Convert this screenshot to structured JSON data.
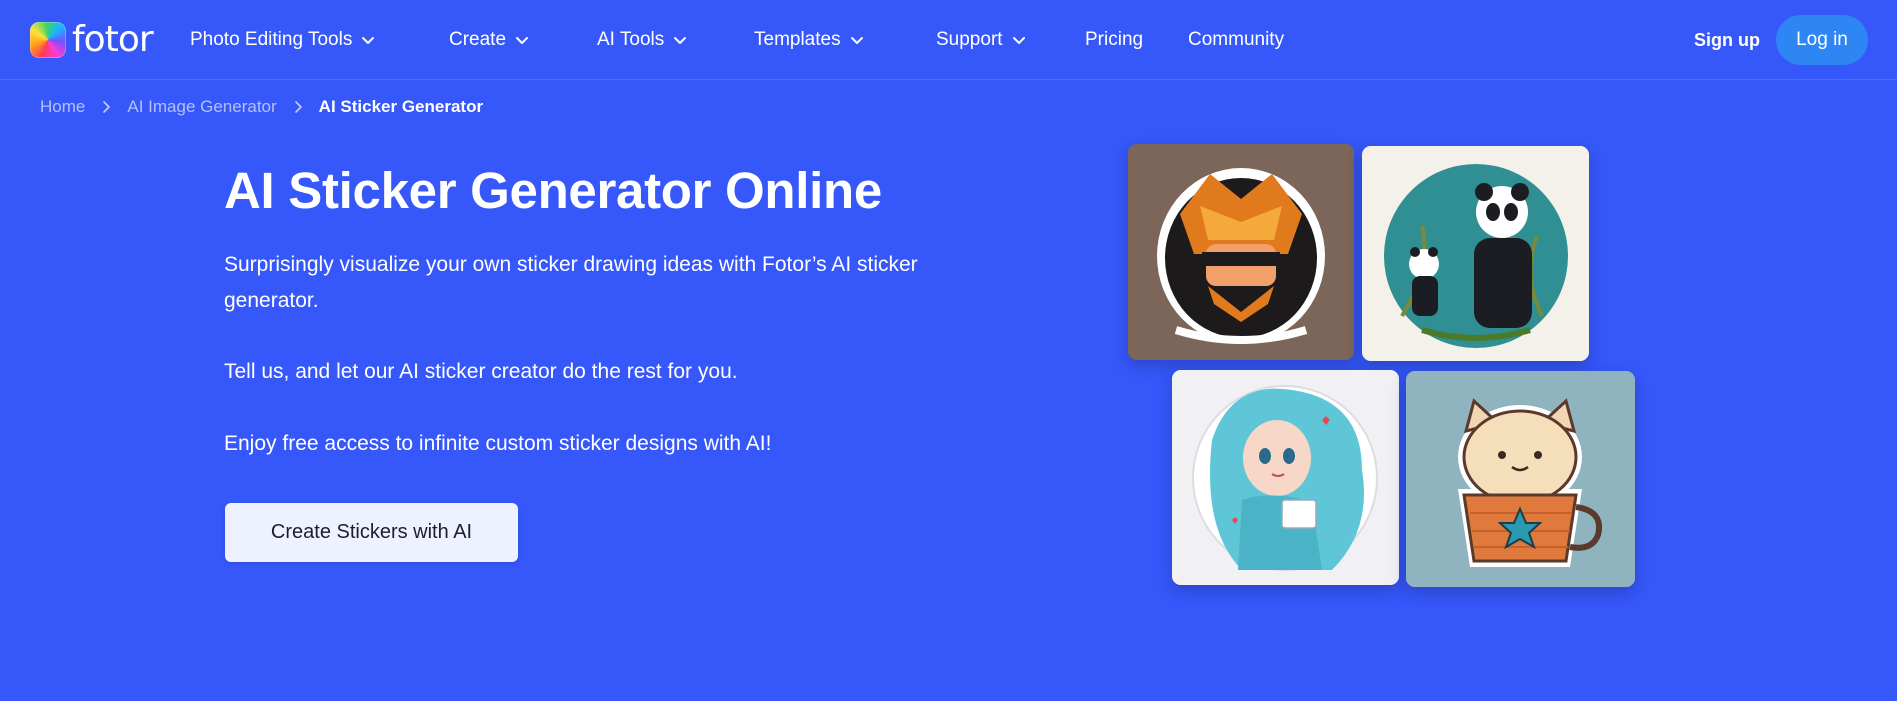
{
  "header": {
    "logo_text": "fotor",
    "nav": [
      {
        "label": "Photo Editing Tools",
        "has_dropdown": true
      },
      {
        "label": "Create",
        "has_dropdown": true
      },
      {
        "label": "AI Tools",
        "has_dropdown": true
      },
      {
        "label": "Templates",
        "has_dropdown": true
      },
      {
        "label": "Support",
        "has_dropdown": true
      },
      {
        "label": "Pricing",
        "has_dropdown": false
      },
      {
        "label": "Community",
        "has_dropdown": false
      }
    ],
    "signup_label": "Sign up",
    "login_label": "Log in"
  },
  "breadcrumb": {
    "items": [
      "Home",
      "AI Image Generator",
      "AI Sticker Generator"
    ]
  },
  "hero": {
    "title": "AI Sticker Generator Online",
    "paragraphs": [
      "Surprisingly visualize your own sticker drawing ideas with Fotor’s AI sticker generator.",
      "Tell us, and let our AI sticker creator do the rest for you.",
      "Enjoy free access to infinite custom sticker designs with AI!"
    ],
    "cta_label": "Create Stickers with AI"
  },
  "colors": {
    "background": "#3658fa",
    "login_button": "#2e86f5",
    "cta_background": "#eef1ff"
  },
  "icons": {
    "dropdown": "chevron-down-icon",
    "breadcrumb_separator": "chevron-right-icon"
  }
}
